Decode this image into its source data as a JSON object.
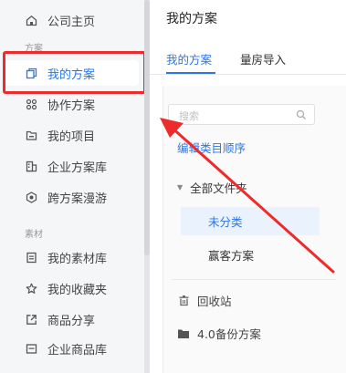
{
  "sidebar": {
    "home_label": "公司主页",
    "section_scheme": "方案",
    "items_scheme": [
      {
        "label": "我的方案",
        "icon": "copy-icon"
      },
      {
        "label": "协作方案",
        "icon": "grid-icon"
      },
      {
        "label": "我的项目",
        "icon": "folder-icon"
      },
      {
        "label": "企业方案库",
        "icon": "building-icon"
      },
      {
        "label": "跨方案漫游",
        "icon": "roam-icon"
      }
    ],
    "section_material": "素材",
    "items_material": [
      {
        "label": "我的素材库",
        "icon": "document-icon"
      },
      {
        "label": "我的收藏夹",
        "icon": "star-icon"
      },
      {
        "label": "商品分享",
        "icon": "share-icon"
      },
      {
        "label": "企业商品库",
        "icon": "list-icon"
      }
    ]
  },
  "main": {
    "title": "我的方案",
    "tabs": [
      {
        "label": "我的方案",
        "active": true
      },
      {
        "label": "量房导入",
        "active": false
      }
    ],
    "search_placeholder": "搜索",
    "edit_order_label": "编辑类目顺序",
    "tree": {
      "root_label": "全部文件夹",
      "children": [
        {
          "label": "未分类",
          "selected": true
        },
        {
          "label": "赢客方案",
          "selected": false
        }
      ]
    },
    "recycle_label": "回收站",
    "backup_label": "4.0备份方案"
  },
  "colors": {
    "accent": "#2a76e8",
    "highlight": "#ee2b2b",
    "annotation_arrow": "#ee2b2b"
  }
}
